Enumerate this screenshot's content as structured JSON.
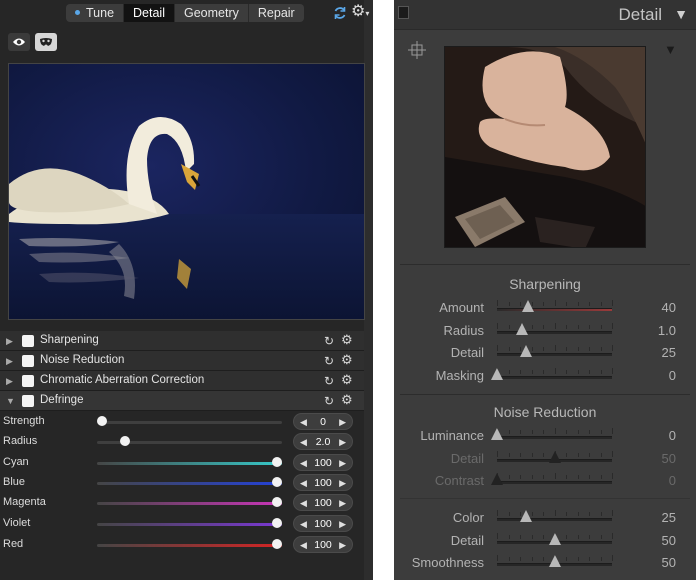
{
  "left": {
    "tabs": [
      "Tune",
      "Detail",
      "Geometry",
      "Repair"
    ],
    "active_tab": "Detail",
    "sections": [
      {
        "label": "Sharpening",
        "expanded": false
      },
      {
        "label": "Noise Reduction",
        "expanded": false
      },
      {
        "label": "Chromatic Aberration Correction",
        "expanded": false
      },
      {
        "label": "Defringe",
        "expanded": true
      }
    ],
    "defringe": [
      {
        "label": "Strength",
        "value": "0",
        "fraction": 0.0,
        "track": "#3f3f3f"
      },
      {
        "label": "Radius",
        "value": "2.0",
        "fraction": 0.13,
        "track": "#3f3f3f"
      },
      {
        "label": "Cyan",
        "value": "100",
        "fraction": 1.0,
        "track": "linear-gradient(90deg,#454545,#36c9c9)"
      },
      {
        "label": "Blue",
        "value": "100",
        "fraction": 1.0,
        "track": "linear-gradient(90deg,#454545,#2442d8)"
      },
      {
        "label": "Magenta",
        "value": "100",
        "fraction": 1.0,
        "track": "linear-gradient(90deg,#454545,#c935b8)"
      },
      {
        "label": "Violet",
        "value": "100",
        "fraction": 1.0,
        "track": "linear-gradient(90deg,#454545,#7a38d4)"
      },
      {
        "label": "Red",
        "value": "100",
        "fraction": 1.0,
        "track": "linear-gradient(90deg,#454545,#d42424)"
      }
    ]
  },
  "right": {
    "panel_title": "Detail",
    "sharpening_title": "Sharpening",
    "sharpening": [
      {
        "label": "Amount",
        "value": "40",
        "fraction": 0.27,
        "dim": false,
        "track": "linear-gradient(90deg,#2a2a2a,#9a3a3a)"
      },
      {
        "label": "Radius",
        "value": "1.0",
        "fraction": 0.22,
        "dim": false
      },
      {
        "label": "Detail",
        "value": "25",
        "fraction": 0.25,
        "dim": false
      },
      {
        "label": "Masking",
        "value": "0",
        "fraction": 0.0,
        "dim": false
      }
    ],
    "noise_title": "Noise Reduction",
    "noise": [
      {
        "label": "Luminance",
        "value": "0",
        "fraction": 0.0,
        "dim": false
      },
      {
        "label": "Detail",
        "value": "50",
        "fraction": 0.5,
        "dim": true
      },
      {
        "label": "Contrast",
        "value": "0",
        "fraction": 0.0,
        "dim": true
      }
    ],
    "color": [
      {
        "label": "Color",
        "value": "25",
        "fraction": 0.25,
        "dim": false
      },
      {
        "label": "Detail",
        "value": "50",
        "fraction": 0.5,
        "dim": false
      },
      {
        "label": "Smoothness",
        "value": "50",
        "fraction": 0.5,
        "dim": false
      }
    ]
  }
}
